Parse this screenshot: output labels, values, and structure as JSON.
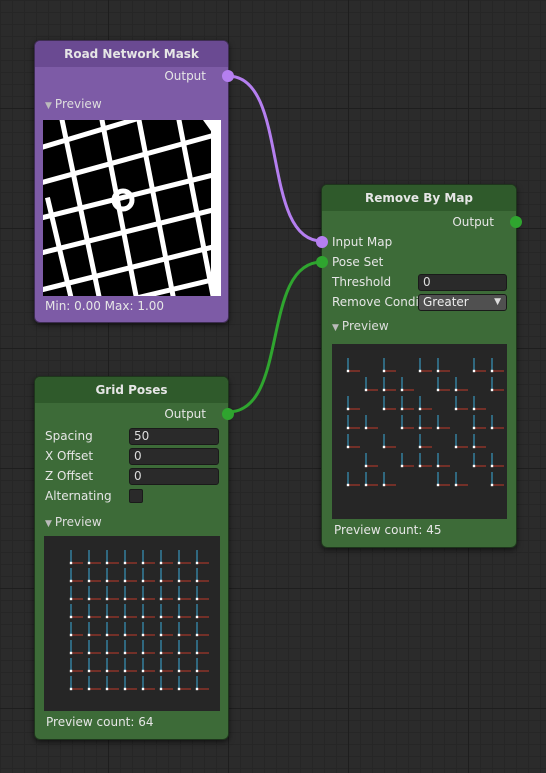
{
  "canvas": {
    "wire_purple": "#b57ff0",
    "wire_green": "#2fa52f"
  },
  "road_node": {
    "title": "Road Network Mask",
    "output_label": "Output",
    "preview_label": "Preview",
    "minmax_text": "Min: 0.00 Max: 1.00",
    "color": "#7d5ba6"
  },
  "remove_node": {
    "title": "Remove By Map",
    "output_label": "Output",
    "input_map_label": "Input Map",
    "pose_set_label": "Pose Set",
    "threshold_label": "Threshold",
    "threshold_value": "0",
    "remove_cond_label": "Remove Condi",
    "remove_cond_value": "Greater",
    "preview_label": "Preview",
    "preview_count": "Preview count: 45",
    "color": "#3d6b38"
  },
  "grid_node": {
    "title": "Grid Poses",
    "output_label": "Output",
    "spacing_label": "Spacing",
    "spacing_value": "50",
    "x_offset_label": "X Offset",
    "x_offset_value": "0",
    "z_offset_label": "Z Offset",
    "z_offset_value": "0",
    "alternating_label": "Alternating",
    "alternating_checked": false,
    "preview_label": "Preview",
    "preview_count": "Preview count: 64",
    "color": "#3d6b38"
  },
  "icons": {
    "collapse": "triangle-down-icon",
    "dropdown": "caret-down-icon"
  }
}
